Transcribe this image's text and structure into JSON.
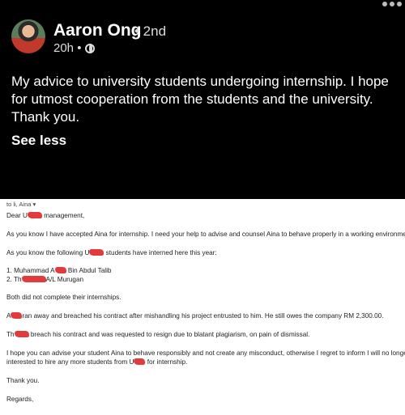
{
  "post": {
    "author_name": "Aaron Ong",
    "connection_degree": "• 2nd",
    "timestamp": "20h •",
    "text": "My advice to university students undergoing internship.  I hope for utmost cooperation from the students and the university. Thank you.",
    "see_less_label": "See less"
  },
  "email": {
    "recipients": "to li, Aina",
    "greeting_prefix": "Dear U",
    "greeting_suffix": " management,",
    "para1": "As you know I have accepted Aina for internship.  I need your help to advise and counsel Aina to behave properly in a working environment.",
    "para2_prefix": "As you know the following U",
    "para2_suffix": " students have interned here this year:",
    "student1_prefix": "1. Muhammad A",
    "student1_suffix": " Bin Abdul Talib",
    "student2_prefix": "2. Th",
    "student2_suffix": "A/L Murugan",
    "para3": "Both did not complete their internships.",
    "para4_prefix": "A",
    "para4_suffix": "ran away and breached his contract after mishandling his project entrusted to him.  He still owes the company RM 2,300.00.",
    "para5_prefix": "Th",
    "para5_suffix": " breach his contract and was requested to resign due to blatant plagiarism, on pain of dismissal.",
    "para6_line1": "I hope you can advise your student Aina to behave responsibly and not create any misconduct, otherwise I regret to inform I will no longer be",
    "para6_line2_prefix": "interested to hire any more students from U",
    "para6_line2_suffix": " for internship.",
    "thanks": "Thank you.",
    "regards": "Regards,"
  }
}
